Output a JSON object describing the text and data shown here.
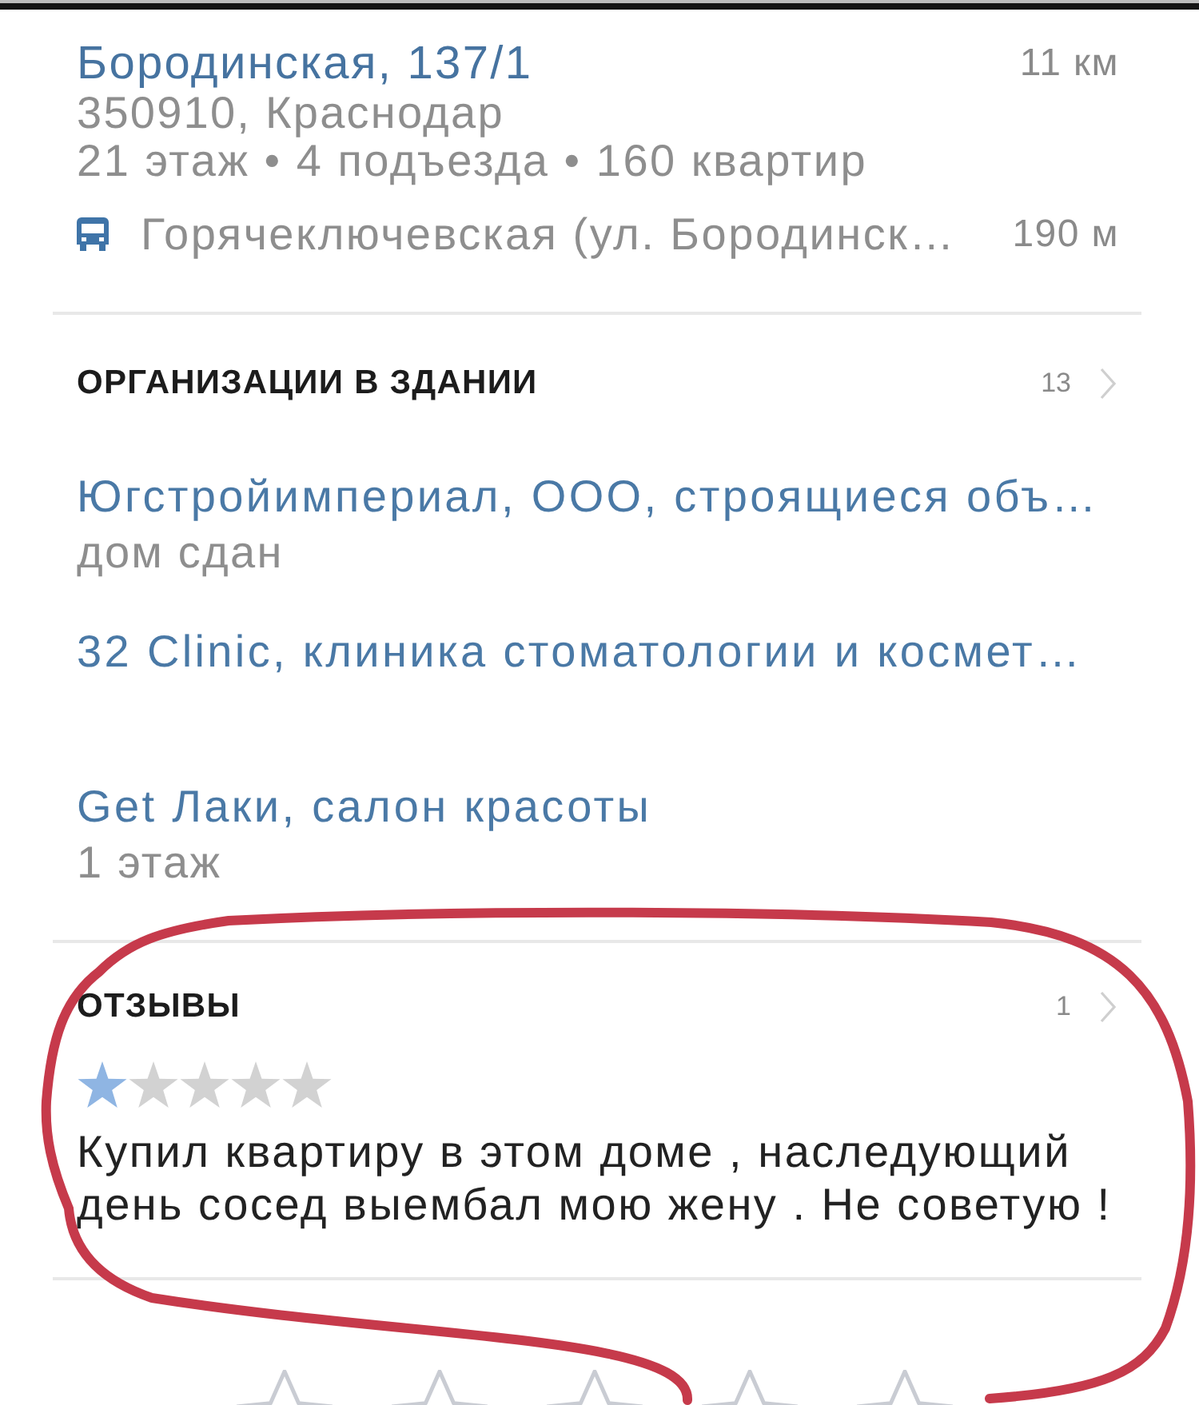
{
  "address": {
    "title": "Бородинская, 137/1",
    "distance": "11 км",
    "postal_city": "350910, Краснодар",
    "details": "21 этаж • 4 подъезда • 160 квартир",
    "stop": {
      "name": "Горячеключевская (ул. Бородинск…",
      "distance": "190 м"
    }
  },
  "organizations": {
    "heading": "ОРГАНИЗАЦИИ В ЗДАНИИ",
    "count": "13",
    "items": [
      {
        "name": "Югстройимпериал, ООО, строящиеся объ…",
        "note": "дом сдан"
      },
      {
        "name": "32 Clinic, клиника стоматологии и космет…"
      },
      {
        "name": "Get Лаки, салон красоты",
        "note": "1 этаж"
      }
    ]
  },
  "reviews": {
    "heading": "ОТЗЫВЫ",
    "count": "1",
    "circled": true,
    "items": [
      {
        "stars": 1,
        "text": "Купил квартиру в этом доме , наследующий день сосед выембал мою жену . Не советую !"
      }
    ]
  }
}
